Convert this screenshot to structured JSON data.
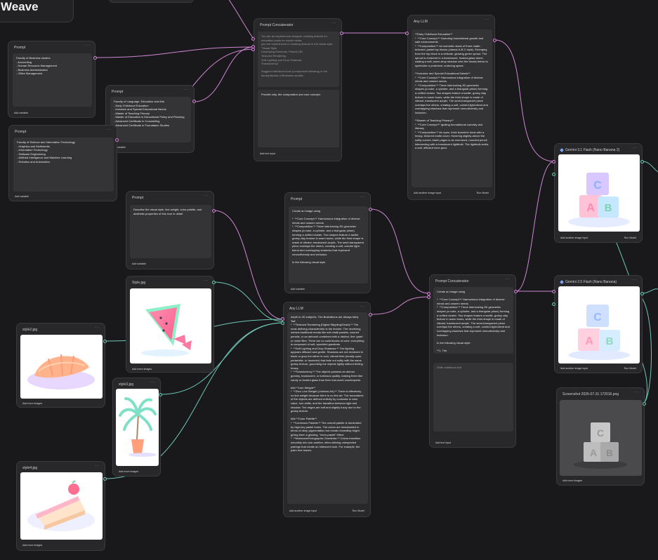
{
  "app": {
    "brand": "Weave"
  },
  "nodes": {
    "prompt1": {
      "title": "Prompt",
      "text": "Faculty of Business studies\n- Accounting\n- Human Resource Management\n- Business Administration\n- Office Management",
      "footer": "Add variable"
    },
    "prompt2": {
      "title": "Prompt",
      "text": "Faculty of Language, Education and Arts\n- Early Childhood Education\n- Inclusive and Special Educational Needs\n- Master of Teaching Primary\n- Master of Education in Educational Policy and Planning\n- Advanced Certificate in Counselling\n- Advanced Certificate in Foundation Studies",
      "footer": "Add variable"
    },
    "prompt3": {
      "title": "Prompt",
      "text": "Faculty of Science and Information Technology\n- Graphics and Multimedia\n- Information Technology\n- Software Engineering\n- Artificial Intelligence and Machine Learning\n- Robotics and Automation",
      "footer": "Add variable"
    },
    "concat1": {
      "title": "Prompt Concatenator",
      "text1": "You are an experienced designer creating artwork for education posts for social media.\nyou are experienced in creating artwork in the visual style \"Visual Style\nUnderlying Elements, Pseudo-3D\nTextured Rendering\nSoft Lighting and Drop Shadows\nTranslucency\"\n\nSuggest individual icons (component following) in the faculty/faculty of Business studies.",
      "text2": "Provide only, the composition and core concept.",
      "footer": "Add text input"
    },
    "llm1": {
      "title": "Any LLM",
      "text": "**Early Childhood Education**\n*  **Core Concept:** Nurturing foundational growth and safe environments.\n*  **Composition:** An isometric stack of three matte-textured, pastel toy blocks (classic A-B-C style). Emerging from the top block is a delicate, glowing green sprout. The sprout is rendered in a translucent, frosted-glass dome, casting a soft, warm-drop shadow onto the blocks below to symbolize a protected, nurturing space.\n\n**Inclusive and Special Educational Needs**\n*  **Core Concept:** Harmonious integration of diverse minds and unseen needs.\n*  **Composition:** Three interlocking 3D geometric shapes (a cube, a cylinder, and a triangular prism) forming a unified cluster. Two shapes feature a tactile, grainy clay texture in warm tones, while the third shape is made of vibrant, translucent acrylic. The semi-transparent piece overlaps the others, creating a soft, colorful light-blend and overlapping shadows that represent neurodiversity and inclusion.\n\n**Master of Teaching Primary**\n*  **Core Concept:** Igniting foundational curiosity and literacy.\n*  **Composition:** An open, thick isometric book with a heavy, textured matte cover. Hovering slightly above the softly curved, blank pages is an oversized, rounded pencil intersecting with a translucent lightbulb. The lightbulb emits a soft, diffused inner glow",
      "footer": "Add another image input",
      "model": "Run Model"
    },
    "prompt4": {
      "title": "Prompt",
      "text": "Describe the visual style, line weight, color palette, and aesthetic properties of this icon in detail",
      "footer": "Add variable"
    },
    "prompt5": {
      "title": "Prompt",
      "text": "Create an image using\n\n*  **Core Concept:** Harmonious integration of diverse minds and unseen needs.\n*  **Composition:** Three interlocking 3D geometric shapes (a cube, a cylinder, and a triangular prism) forming a unified cluster. Two shapes feature a tactile, grainy clay texture in warm tones, while the third shape is made of vibrant, translucent acrylic. The semi-transparent piece overlaps the others, creating a soft, colorful light-blend and overlapping shadows that represent neurodiversity and inclusion.\n\nIn the following visual style",
      "footer": "Add variable"
    },
    "styleImg": {
      "title": "Style.jpg",
      "footer": "Add more images"
    },
    "style2": {
      "title": "style2.jpg",
      "footer": "Add more images"
    },
    "style3": {
      "title": "style3.jpg",
      "footer": "Add more images"
    },
    "style4": {
      "title": "style4.jpg",
      "footer": "Add more images"
    },
    "llm2": {
      "title": "Any LLM",
      "text": "depth to 2D subjects. The illustrations are always fairly 'flat'.\n*  **Textured Rendering (Digital Stippling/Grain):** The most defining characteristic is the texture. The rendering mimics traditional media like soft chalk pastels, colored pencils, or an airbrush combined with a distinct, fine 'grain' or noise filter. There are no solid blocks of color; everything is composed of soft, speckled gradients.\n*  **Soft Lighting and Drop Shadows:** The lighting appears diffused and gentle. Shadows are not rendered in black or grey but rather in cool, vibrant tints (mostly cyan, periwinkle, or lavender) that fade out softly with the same grainy texture, grounding the objects lightly without feeling heavy.\n*  **Translucency:** The objects possess an almost gummy, translucent, or luminous quality, making them like candy or frosted glass than their real-world counterparts.\n\n### **Line Weight**\n*  **Zero Line Weight (Lineless Art):** There is effectively no line weight because there is no line art. The boundaries of the objects are defined entirely by contrasts in color value, hue shifts, and the transition between light and shadow. The edges are soft and slightly fuzzy due to the grainy texture.\n\n### **Color Palette**\n*  **Luminous Pastels:** The overall palette is dominated by high-key pastel tones. The colors are desaturated in terms of deep pigmentation but remain incredibly bright, giving them a glowing, \"neon-pastel\" effect.\n*  **Iridescent/Holographic Gradients:** Colors transition smoothly into one another, often utilizing unexpected pairings that create an iridescent look. For example, the palm tree leaves",
      "footer": "Add another image input",
      "model": "Run Model"
    },
    "concat2": {
      "title": "Prompt Concatenator",
      "text1": "Create an image using\n\n*  **Core Concept:** Harmonious integration of diverse minds and unseen needs.\n*  **Composition:** Three interlocking 3D geometric shapes (a cube, a cylinder, and a triangular prism) forming a unified cluster. Two shapes feature a tactile, grainy clay texture in warm tones, while the third shape is made of vibrant, translucent acrylic. The semi-transparent piece overlaps the others, creating a soft, colorful light-blend and overlapping shadows that represent neurodiversity and inclusion.\n\nIn the following visual style:\n\n**1. The",
      "placeholder": "Write additional text",
      "footer": "Add text input"
    },
    "gemini1": {
      "title": "Gemini 3.1 Flash (Nano Banana 2)",
      "footer": "Add another image input",
      "model": "Run Model"
    },
    "gemini2": {
      "title": "Gemini 2.5 Flash (Nano Banana)",
      "footer": "Add another image input",
      "model": "Run Model"
    },
    "screenshot": {
      "title": "Screenshot 2026-07-31 172016.png",
      "footer": "Add more images"
    }
  },
  "colors": {
    "wire_text": "#d086d4",
    "wire_image": "#6fc7b4",
    "node_bg": "#28282b",
    "canvas_bg": "#19191b"
  }
}
